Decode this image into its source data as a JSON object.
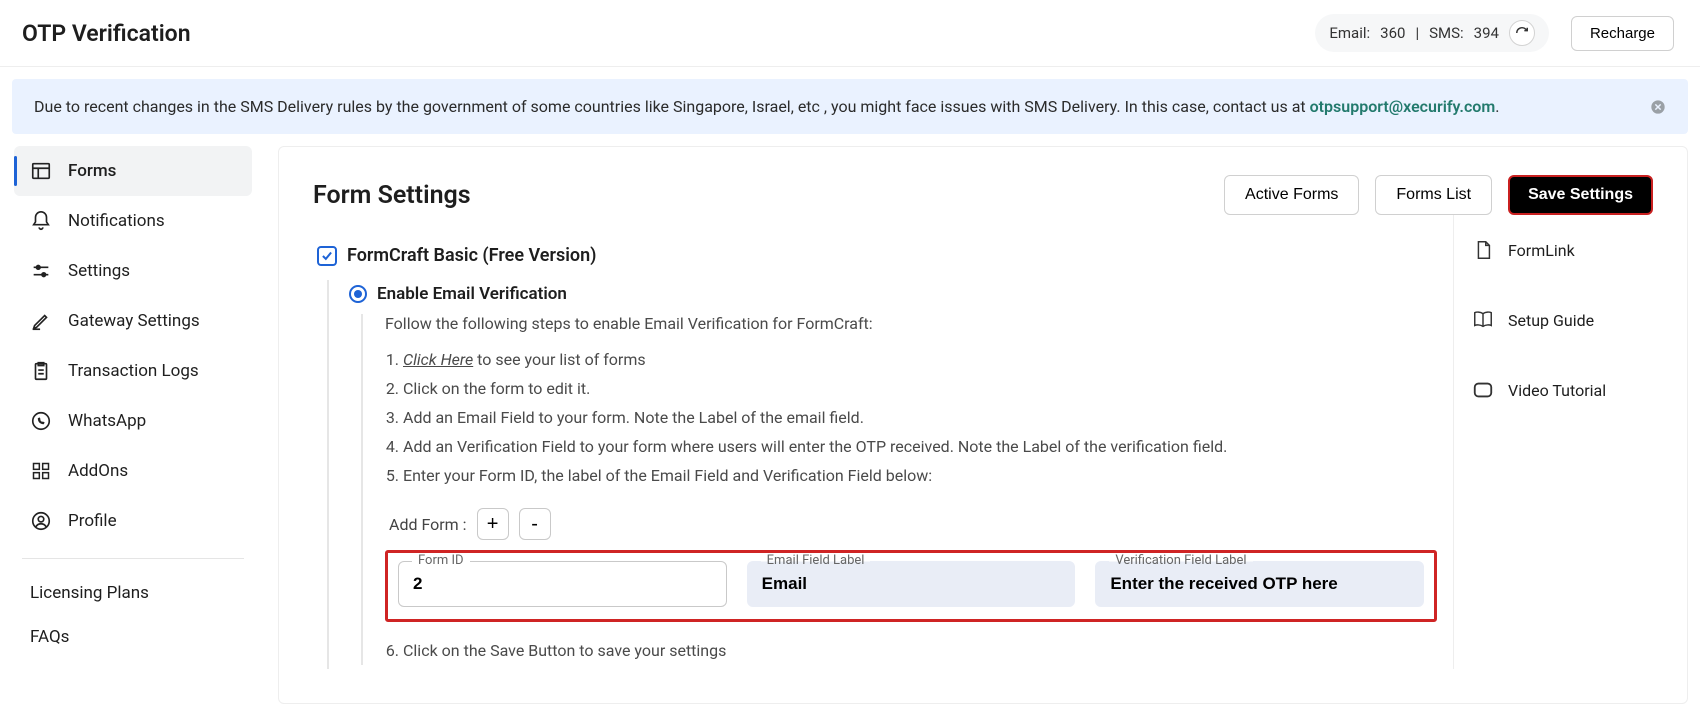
{
  "topbar": {
    "title": "OTP Verification",
    "credits_email_label": "Email:",
    "credits_email_value": "360",
    "credits_sep": " | ",
    "credits_sms_label": "SMS: ",
    "credits_sms_value": "394",
    "recharge_label": "Recharge"
  },
  "notice": {
    "text_pre": "Due to recent changes in the SMS Delivery rules by the government of some countries like Singapore, Israel, etc , you might face issues with SMS Delivery. In this case, contact us at ",
    "link": "otpsupport@xecurify.com",
    "suffix": "."
  },
  "sidebar": {
    "items": [
      {
        "label": "Forms",
        "icon": "layout-icon"
      },
      {
        "label": "Notifications",
        "icon": "bell-icon"
      },
      {
        "label": "Settings",
        "icon": "sliders-icon"
      },
      {
        "label": "Gateway Settings",
        "icon": "pen-icon"
      },
      {
        "label": "Transaction Logs",
        "icon": "clipboard-icon"
      },
      {
        "label": "WhatsApp",
        "icon": "whatsapp-icon"
      },
      {
        "label": "AddOns",
        "icon": "grid-icon"
      },
      {
        "label": "Profile",
        "icon": "user-circle-icon"
      }
    ],
    "licensing_label": "Licensing Plans",
    "faqs_label": "FAQs"
  },
  "card": {
    "title": "Form Settings",
    "btn_active": "Active Forms",
    "btn_list": "Forms List",
    "btn_save": "Save Settings",
    "section_label": "FormCraft Basic (Free Version)",
    "radio_label": "Enable Email Verification",
    "instruction": "Follow the following steps to enable Email Verification for FormCraft:",
    "step1_em": "Click Here",
    "step1_rest": " to see your list of forms",
    "step2": "Click on the form to edit it.",
    "step3": "Add an Email Field to your form. Note the Label of the email field.",
    "step4": "Add an Verification Field to your form where users will enter the OTP received. Note the Label of the verification field.",
    "step5": "Enter your Form ID, the label of the Email Field and Verification Field below:",
    "step6": "Click on the Save Button to save your settings",
    "add_form_label": "Add Form :",
    "field_form_id_label": "Form ID",
    "field_form_id_value": "2",
    "field_email_label": "Email Field Label",
    "field_email_value": "Email",
    "field_verif_label": "Verification Field Label",
    "field_verif_value": "Enter the received OTP here"
  },
  "right_panel": {
    "formlink": "FormLink",
    "setup": "Setup Guide",
    "video": "Video Tutorial"
  }
}
